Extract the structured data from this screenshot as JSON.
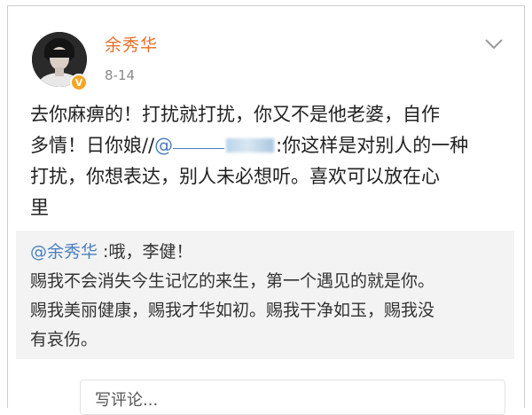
{
  "post": {
    "username": "余秀华",
    "time": "8-14",
    "text_line1": "去你麻痹的！打扰就打扰，你又不是他老婆，自作",
    "text_line2_a": "多情！日你娘//",
    "text_line2_mention": "@",
    "text_line2_b": ":你这样是对别人的一种",
    "text_line3": "打扰，你想表达，别人未必想听。喜欢可以放在心",
    "text_line4": "里",
    "icons": {
      "avatar": "avatar",
      "verified": "verified-badge-icon",
      "more": "chevron-down-icon"
    }
  },
  "repost": {
    "author": "@余秀华",
    "line1_rest": " :哦，李健！",
    "line2": "赐我不会消失今生记忆的来生，第一个遇见的就是你。",
    "line3": "赐我美丽健康，赐我才华如初。赐我干净如玉，赐我没",
    "line4": "有哀伤。"
  },
  "comment": {
    "placeholder": "写评论..."
  },
  "colors": {
    "username": "#e8702a",
    "mention": "#4a7fc1",
    "repost_bg": "#f3f3f3",
    "verified": "#f5a623"
  }
}
